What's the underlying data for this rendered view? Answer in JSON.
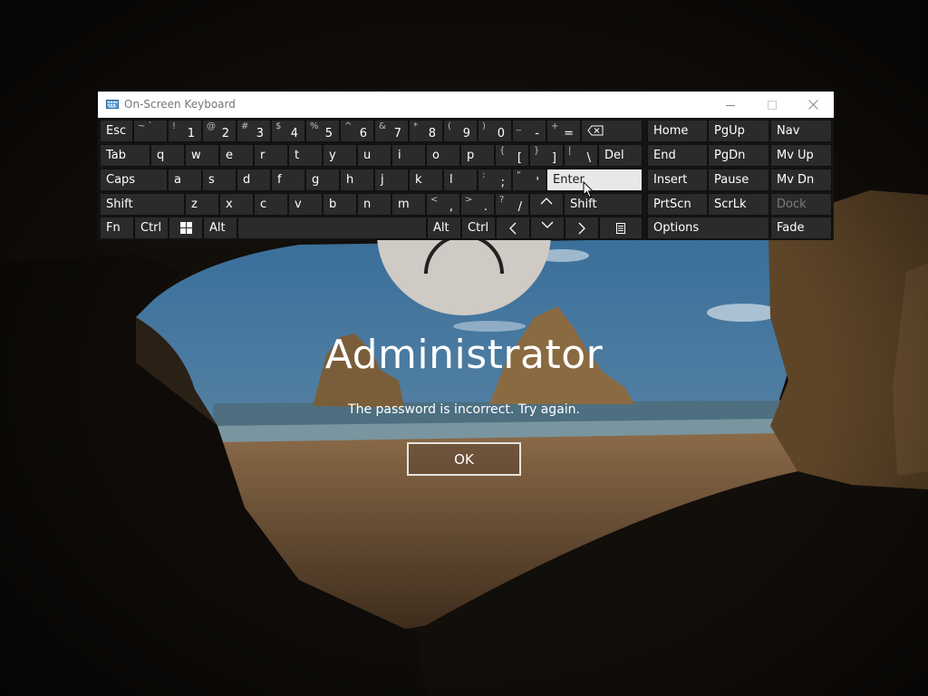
{
  "lock_screen": {
    "user_name": "Administrator",
    "message": "The password is incorrect. Try again.",
    "ok_label": "OK"
  },
  "osk": {
    "title": "On-Screen Keyboard",
    "keys": {
      "esc": "Esc",
      "tilde": {
        "s": "~ `",
        "m": ""
      },
      "k1": {
        "s": "!",
        "m": "1"
      },
      "k2": {
        "s": "@",
        "m": "2"
      },
      "k3": {
        "s": "#",
        "m": "3"
      },
      "k4": {
        "s": "$",
        "m": "4"
      },
      "k5": {
        "s": "%",
        "m": "5"
      },
      "k6": {
        "s": "^",
        "m": "6"
      },
      "k7": {
        "s": "&",
        "m": "7"
      },
      "k8": {
        "s": "*",
        "m": "8"
      },
      "k9": {
        "s": "(",
        "m": "9"
      },
      "k0": {
        "s": ")",
        "m": "0"
      },
      "minus": {
        "s": "_",
        "m": "-"
      },
      "equals": {
        "s": "+",
        "m": "="
      },
      "home": "Home",
      "pgup": "PgUp",
      "nav": "Nav",
      "tab": "Tab",
      "q": "q",
      "w": "w",
      "e": "e",
      "r": "r",
      "t": "t",
      "y": "y",
      "u": "u",
      "i": "i",
      "o": "o",
      "p": "p",
      "lbracket": {
        "s": "{",
        "m": "["
      },
      "rbracket": {
        "s": "}",
        "m": "]"
      },
      "backslash": {
        "s": "|",
        "m": "\\"
      },
      "del": "Del",
      "end": "End",
      "pgdn": "PgDn",
      "mvup": "Mv Up",
      "caps": "Caps",
      "a": "a",
      "s": "s",
      "d": "d",
      "f": "f",
      "g": "g",
      "h": "h",
      "j": "j",
      "k": "k",
      "l": "l",
      "semicolon": {
        "s": ":",
        "m": ";"
      },
      "quote": {
        "s": "\"",
        "m": "'"
      },
      "enter": "Enter",
      "insert": "Insert",
      "pause": "Pause",
      "mvdn": "Mv Dn",
      "shift_left": "Shift",
      "z": "z",
      "x": "x",
      "c": "c",
      "v": "v",
      "b": "b",
      "n": "n",
      "m": "m",
      "comma": {
        "s": "<",
        "m": ","
      },
      "period": {
        "s": ">",
        "m": "."
      },
      "slash": {
        "s": "?",
        "m": "/"
      },
      "shift_right": "Shift",
      "prtscn": "PrtScn",
      "scrlk": "ScrLk",
      "dock": "Dock",
      "fn": "Fn",
      "ctrl_left": "Ctrl",
      "alt_left": "Alt",
      "alt_right": "Alt",
      "ctrl_right": "Ctrl",
      "options": "Options",
      "fade": "Fade"
    }
  }
}
